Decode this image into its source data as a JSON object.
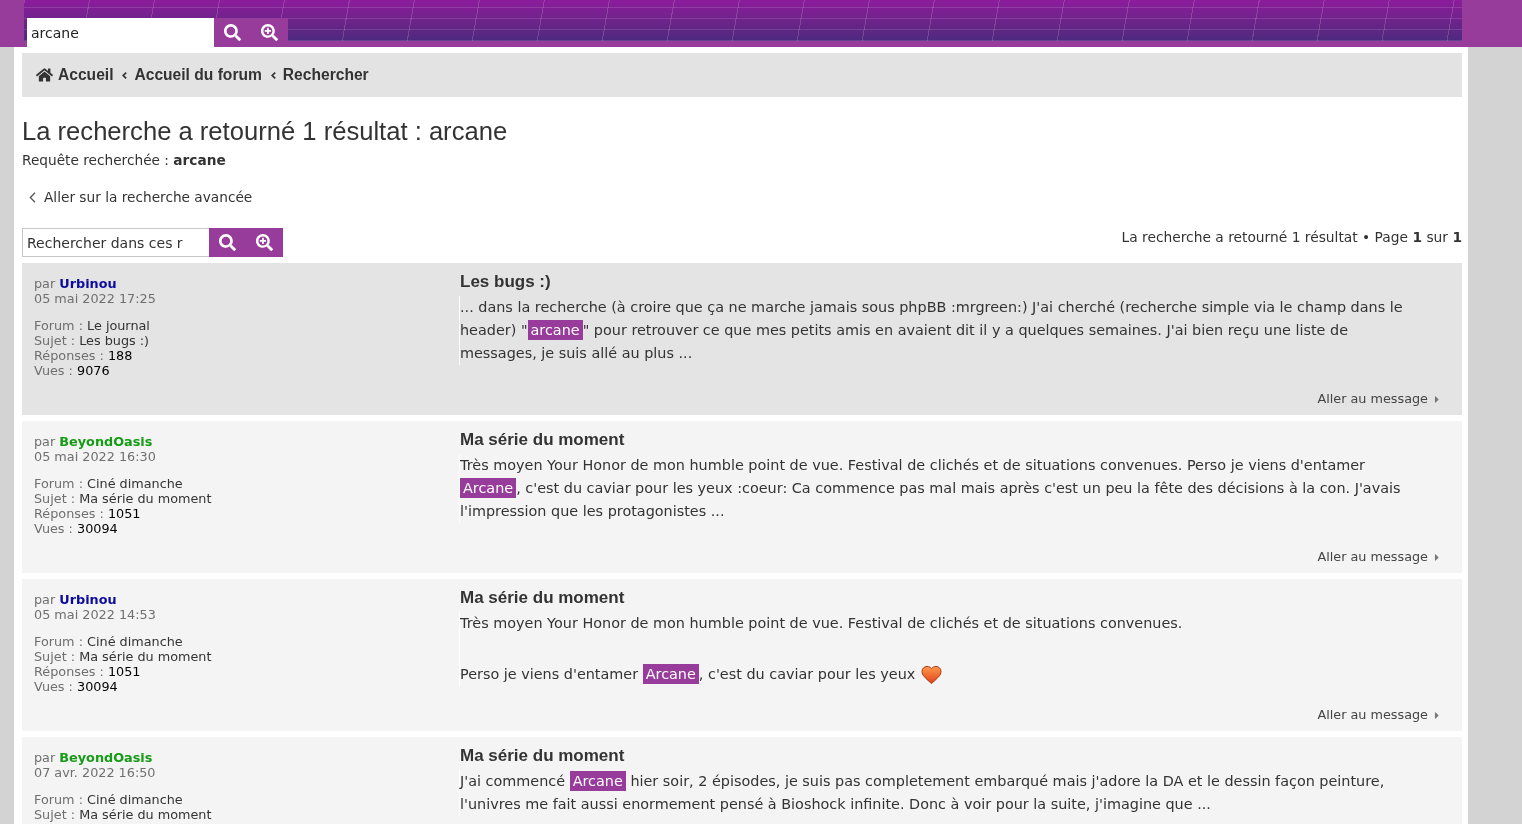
{
  "header": {
    "search": {
      "value": "arcane"
    }
  },
  "breadcrumbs": [
    {
      "kind": "home",
      "label": "Accueil"
    },
    {
      "kind": "link",
      "label": "Accueil du forum"
    },
    {
      "kind": "link",
      "label": "Rechercher"
    }
  ],
  "page_title": "La recherche a retourné 1 résultat : arcane",
  "query": "Requête recherchée : **arcane**",
  "advanced_search_link": "Aller sur la recherche avancée",
  "results_search": {
    "placeholder": "Rechercher dans ces r"
  },
  "pagination": "La recherche a retourné 1 résultat • Page **1** sur **1**",
  "posts": [
    {
      "highlighted": true,
      "by": "par",
      "author": {
        "name": "Urbinou",
        "color": "#0b0b9e"
      },
      "date": "05 mai 2022 17:25",
      "meta": [
        {
          "kind": "forum",
          "label": "Forum :",
          "value": "Le journal"
        },
        {
          "kind": "topic",
          "label": "Sujet :",
          "value": "Les bugs :)"
        },
        {
          "kind": "replies",
          "label": "Réponses :",
          "value": "188"
        },
        {
          "kind": "views",
          "label": "Vues :",
          "value": "9076"
        }
      ],
      "title": "Les bugs :)",
      "body": [
        {
          "smiley": false,
          "segments": [
            {
              "kind": "text",
              "text": "... dans la recherche (à croire que ça ne marche jamais sous phpBB :mrgreen:) J'ai cherché (recherche simple via le champ dans le header) \""
            },
            {
              "kind": "highlight",
              "text": "arcane"
            },
            {
              "kind": "text",
              "text": "\" pour retrouver ce que mes petits amis en avaient dit il y a quelques semaines. J'ai bien reçu une liste de messages, je suis allé au plus ..."
            }
          ]
        }
      ],
      "link": "Aller au message"
    },
    {
      "highlighted": false,
      "by": "par",
      "author": {
        "name": "BeyondOasis",
        "color": "#159b15"
      },
      "date": "05 mai 2022 16:30",
      "meta": [
        {
          "kind": "forum",
          "label": "Forum :",
          "value": "Ciné dimanche"
        },
        {
          "kind": "topic",
          "label": "Sujet :",
          "value": "Ma série du moment"
        },
        {
          "kind": "replies",
          "label": "Réponses :",
          "value": "1051"
        },
        {
          "kind": "views",
          "label": "Vues :",
          "value": "30094"
        }
      ],
      "title": "Ma série du moment",
      "body": [
        {
          "smiley": false,
          "segments": [
            {
              "kind": "text",
              "text": "Très moyen Your Honor de mon humble point de vue. Festival de clichés et de situations convenues. Perso je viens d'entamer "
            },
            {
              "kind": "highlight",
              "text": "Arcane"
            },
            {
              "kind": "text",
              "text": ", c'est du caviar pour les yeux :coeur: Ca commence pas mal mais après c'est un peu la fête des décisions à la con. J'avais l'impression que les protagonistes ..."
            }
          ]
        }
      ],
      "link": "Aller au message"
    },
    {
      "highlighted": false,
      "by": "par",
      "author": {
        "name": "Urbinou",
        "color": "#0b0b9e"
      },
      "date": "05 mai 2022 14:53",
      "meta": [
        {
          "kind": "forum",
          "label": "Forum :",
          "value": "Ciné dimanche"
        },
        {
          "kind": "topic",
          "label": "Sujet :",
          "value": "Ma série du moment"
        },
        {
          "kind": "replies",
          "label": "Réponses :",
          "value": "1051"
        },
        {
          "kind": "views",
          "label": "Vues :",
          "value": "30094"
        }
      ],
      "title": "Ma série du moment",
      "body": [
        {
          "smiley": false,
          "segments": [
            {
              "kind": "text",
              "text": "Très moyen Your Honor de mon humble point de vue. Festival de clichés et de situations convenues."
            }
          ]
        },
        {
          "smiley": true,
          "segments": [
            {
              "kind": "text",
              "text": "Perso je viens d'entamer "
            },
            {
              "kind": "highlight",
              "text": "Arcane"
            },
            {
              "kind": "text",
              "text": ", c'est du caviar pour les yeux"
            }
          ]
        }
      ],
      "link": "Aller au message"
    },
    {
      "highlighted": false,
      "by": "par",
      "author": {
        "name": "BeyondOasis",
        "color": "#159b15"
      },
      "date": "07 avr. 2022 16:50",
      "meta": [
        {
          "kind": "forum",
          "label": "Forum :",
          "value": "Ciné dimanche"
        },
        {
          "kind": "topic",
          "label": "Sujet :",
          "value": "Ma série du moment"
        }
      ],
      "title": "Ma série du moment",
      "body": [
        {
          "smiley": false,
          "segments": [
            {
              "kind": "text",
              "text": "J'ai commencé "
            },
            {
              "kind": "highlight",
              "text": "Arcane"
            },
            {
              "kind": "text",
              "text": " hier soir, 2 épisodes, je suis pas completement embarqué mais j'adore la DA et le dessin façon peinture, l'univres me fait aussi enormement pensé à Bioshock infinite. Donc à voir pour la suite, j'imagine que ..."
            }
          ]
        }
      ]
    }
  ]
}
